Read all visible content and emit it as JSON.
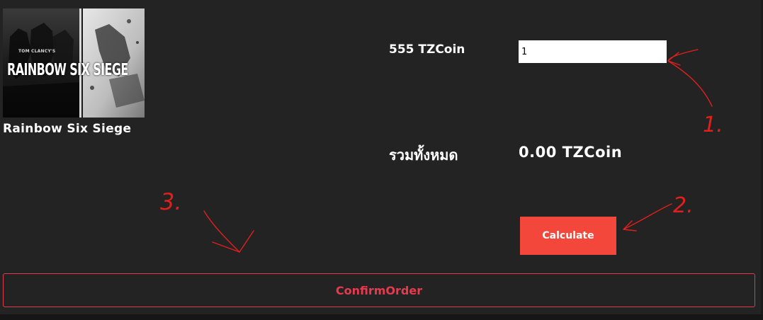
{
  "product": {
    "cover_logo_text": "RAINBOW SIX SIEGE",
    "cover_brand_text": "TOM CLANCY'S",
    "title": "Rainbow Six Siege"
  },
  "order": {
    "price_label": "555 TZCoin",
    "quantity_value": "1",
    "total_label": "รวมทั้งหมด",
    "total_value": "0.00 TZCoin",
    "calculate_label": "Calculate",
    "confirm_label": "ConfirmOrder"
  },
  "annotations": {
    "step1_label": "1.",
    "step2_label": "2.",
    "step3_label": "3.",
    "ink_color": "#e0201c"
  },
  "colors": {
    "background": "#232323",
    "accent_red": "#f2473a",
    "confirm_border": "#e03a4d",
    "text_white": "#ffffff"
  }
}
